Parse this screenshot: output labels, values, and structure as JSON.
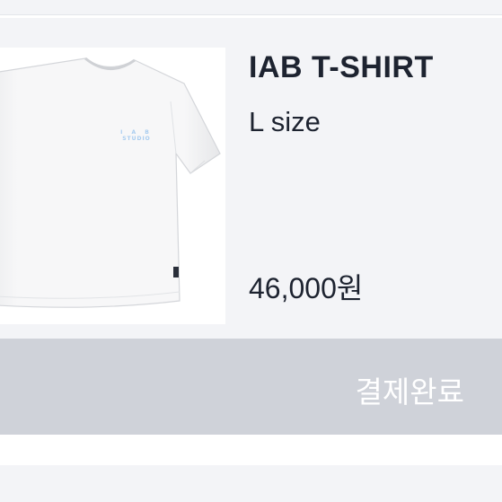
{
  "order": {
    "product_name": "IAB T-SHIRT",
    "option": "L size",
    "price": "46,000원",
    "status_label": "결제완료",
    "image": {
      "type": "white t-shirt",
      "print_text_top": "I A B",
      "print_text_bottom": "STUDIO",
      "print_color": "#a9cdf0"
    }
  },
  "colors": {
    "card_background": "#f3f4f7",
    "status_bar": "#cfd2d9",
    "text_primary": "#1d2330"
  }
}
